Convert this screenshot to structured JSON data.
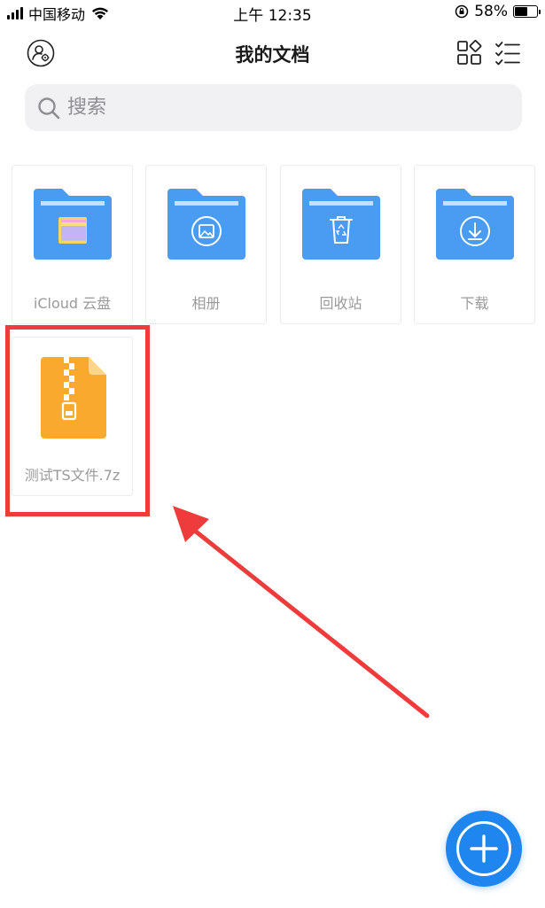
{
  "status_bar": {
    "carrier": "中国移动",
    "time": "上午 12:35",
    "battery": "58%",
    "battery_level": 0.58
  },
  "header": {
    "title": "我的文档"
  },
  "search": {
    "placeholder": "搜索"
  },
  "items": [
    {
      "label": "iCloud 云盘",
      "icon": "folder-files-icon"
    },
    {
      "label": "相册",
      "icon": "folder-photo-icon"
    },
    {
      "label": "回收站",
      "icon": "folder-recycle-icon"
    },
    {
      "label": "下载",
      "icon": "folder-download-icon"
    },
    {
      "label": "测试TS文件.7z",
      "icon": "zip-file-icon"
    }
  ],
  "colors": {
    "folder_blue": "#4a9bf2",
    "zip_orange": "#f9aa2e",
    "accent": "#1f86f0",
    "annotation_red": "#ee3b3b"
  }
}
